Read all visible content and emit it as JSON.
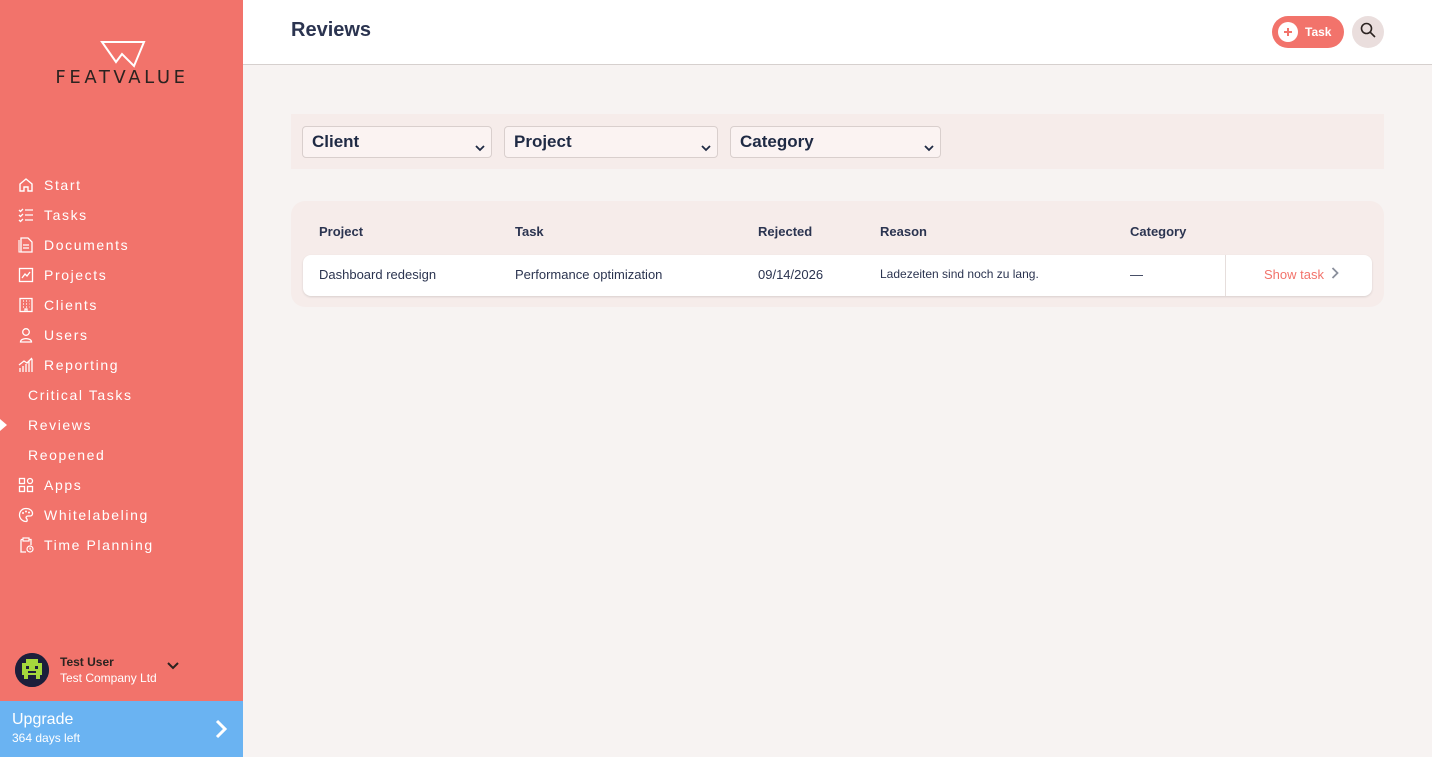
{
  "brand": {
    "name": "FEATVALUE"
  },
  "sidebar": {
    "items": [
      {
        "label": "Start",
        "icon": "home-icon"
      },
      {
        "label": "Tasks",
        "icon": "checklist-icon"
      },
      {
        "label": "Documents",
        "icon": "document-icon"
      },
      {
        "label": "Projects",
        "icon": "chart-board-icon"
      },
      {
        "label": "Clients",
        "icon": "building-icon"
      },
      {
        "label": "Users",
        "icon": "user-icon"
      },
      {
        "label": "Reporting",
        "icon": "bar-chart-icon"
      },
      {
        "label": "Critical Tasks"
      },
      {
        "label": "Reviews",
        "active": true
      },
      {
        "label": "Reopened"
      },
      {
        "label": "Apps",
        "icon": "apps-grid-icon"
      },
      {
        "label": "Whitelabeling",
        "icon": "palette-icon"
      },
      {
        "label": "Time Planning",
        "icon": "clipboard-clock-icon"
      }
    ]
  },
  "user": {
    "name": "Test User",
    "company": "Test Company Ltd"
  },
  "upgrade": {
    "title": "Upgrade",
    "subtitle": "364 days left"
  },
  "header": {
    "title": "Reviews",
    "task_button": "Task"
  },
  "filters": {
    "client": "Client",
    "project": "Project",
    "category": "Category"
  },
  "table": {
    "columns": [
      "Project",
      "Task",
      "Rejected",
      "Reason",
      "Category"
    ],
    "rows": [
      {
        "project": "Dashboard redesign",
        "task": "Performance optimization",
        "rejected": "09/14/2026",
        "reason": "Ladezeiten sind noch zu lang.",
        "category": "—",
        "action": "Show task"
      }
    ]
  },
  "colors": {
    "sidebar": "#f2736b",
    "accent": "#f2736b",
    "upgrade": "#6ab3f2",
    "background": "#f7f3f2"
  }
}
